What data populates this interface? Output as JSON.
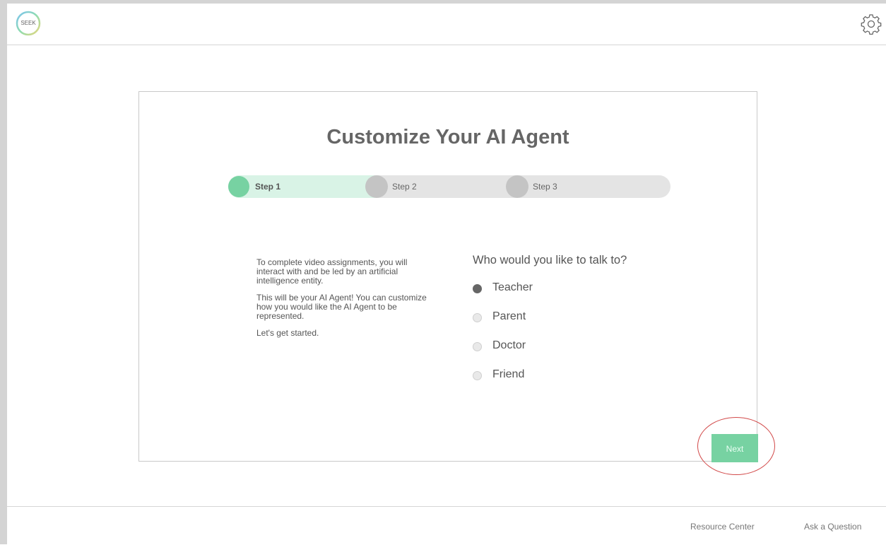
{
  "header": {
    "logo_text": "SEEK",
    "settings_icon": "gear-icon"
  },
  "card": {
    "title": "Customize Your AI Agent",
    "steps": [
      {
        "label": "Step 1",
        "active": true
      },
      {
        "label": "Step 2",
        "active": false
      },
      {
        "label": "Step 3",
        "active": false
      }
    ],
    "intro": [
      "To complete video assignments, you will interact with and be led by an artificial intelligence entity.",
      "This will be your AI Agent! You can customize how you would like the AI Agent to be represented.",
      "Let's get started."
    ],
    "question": "Who would you like to talk to?",
    "options": [
      {
        "label": "Teacher",
        "selected": true
      },
      {
        "label": "Parent",
        "selected": false
      },
      {
        "label": "Doctor",
        "selected": false
      },
      {
        "label": "Friend",
        "selected": false
      }
    ],
    "next_label": "Next"
  },
  "footer": {
    "resource_center": "Resource Center",
    "ask_question": "Ask a Question"
  },
  "colors": {
    "accent": "#77d2a2",
    "accent_light": "#d9f3e6",
    "annotation": "#d24a4a"
  }
}
